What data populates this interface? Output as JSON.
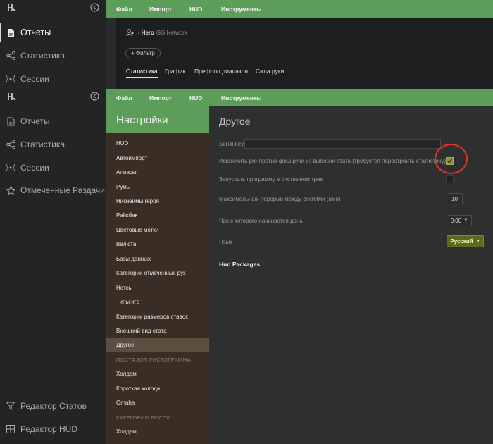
{
  "menus": [
    "Файл",
    "Импорт",
    "HUD",
    "Инструменты"
  ],
  "icons": {
    "logo": "logo-icon",
    "collapse": "collapse-chevron-icon"
  },
  "colors": {
    "accent_green": "#5d9d5a",
    "nav_brown": "#3a2e24",
    "language_button": "#5c6a1d",
    "annotation_red": "#e0332c"
  },
  "bg_sidebar": {
    "items": [
      {
        "label": "Отчеты",
        "icon": "report-icon",
        "active": true
      },
      {
        "label": "Статистика",
        "icon": "share-nodes-icon"
      },
      {
        "label": "Сессии",
        "icon": "broadcast-icon"
      }
    ]
  },
  "bg_panel": {
    "hero_label": "Hero",
    "hero_network": "GG Network",
    "filter_label": "+ Фильтр",
    "tabs": [
      "Статистика",
      "График",
      "Префлоп диапазон",
      "Сила руки"
    ]
  },
  "fg_sidebar": {
    "items": [
      {
        "label": "Отчеты",
        "icon": "report-icon"
      },
      {
        "label": "Статистика",
        "icon": "share-nodes-icon"
      },
      {
        "label": "Сессии",
        "icon": "broadcast-icon"
      },
      {
        "label": "Отмеченные Раздачи",
        "icon": "star-icon"
      }
    ],
    "bottom_items": [
      {
        "label": "Редактор Статов",
        "icon": "filter-icon"
      },
      {
        "label": "Редактор HUD",
        "icon": "hud-grid-icon"
      }
    ]
  },
  "settings": {
    "title": "Настройки",
    "nav_items": [
      "HUD",
      "Автоимпорт",
      "Алиасы",
      "Румы",
      "Никнеймы героя",
      "Рейкбек",
      "Цветовые метки",
      "Валюта",
      "Базы данных",
      "Категории отмеченных рук",
      "Нотсы",
      "Типы игр",
      "Категории размеров ставок",
      "Внешний вид стата",
      "Другое"
    ],
    "section_postflop": "ПОСТФЛОП ГИСТОГРАММА",
    "postflop_items": [
      "Холдем",
      "Короткая колода",
      "Omaha"
    ],
    "section_boards": "КАТЕГОРИИ ДОСОК",
    "board_items": [
      "Холдем"
    ]
  },
  "other": {
    "title": "Другое",
    "serial_key_label": "Serial key",
    "serial_key_value": "",
    "exclude_label": "Исключить pre-против-фиш руки из выборки стата (требуется перестроить статистику)",
    "exclude_checked": true,
    "tray_label": "Запускать программу в системном трее",
    "tray_checked": false,
    "max_break_label": "Максимальный перерыв между сесиями (мин)",
    "max_break_value": "10",
    "day_start_label": "Час с которого начинается день",
    "day_start_value": "0:00",
    "language_label": "Язык",
    "language_value": "Русский",
    "hud_packages_label": "Hud Packages"
  }
}
